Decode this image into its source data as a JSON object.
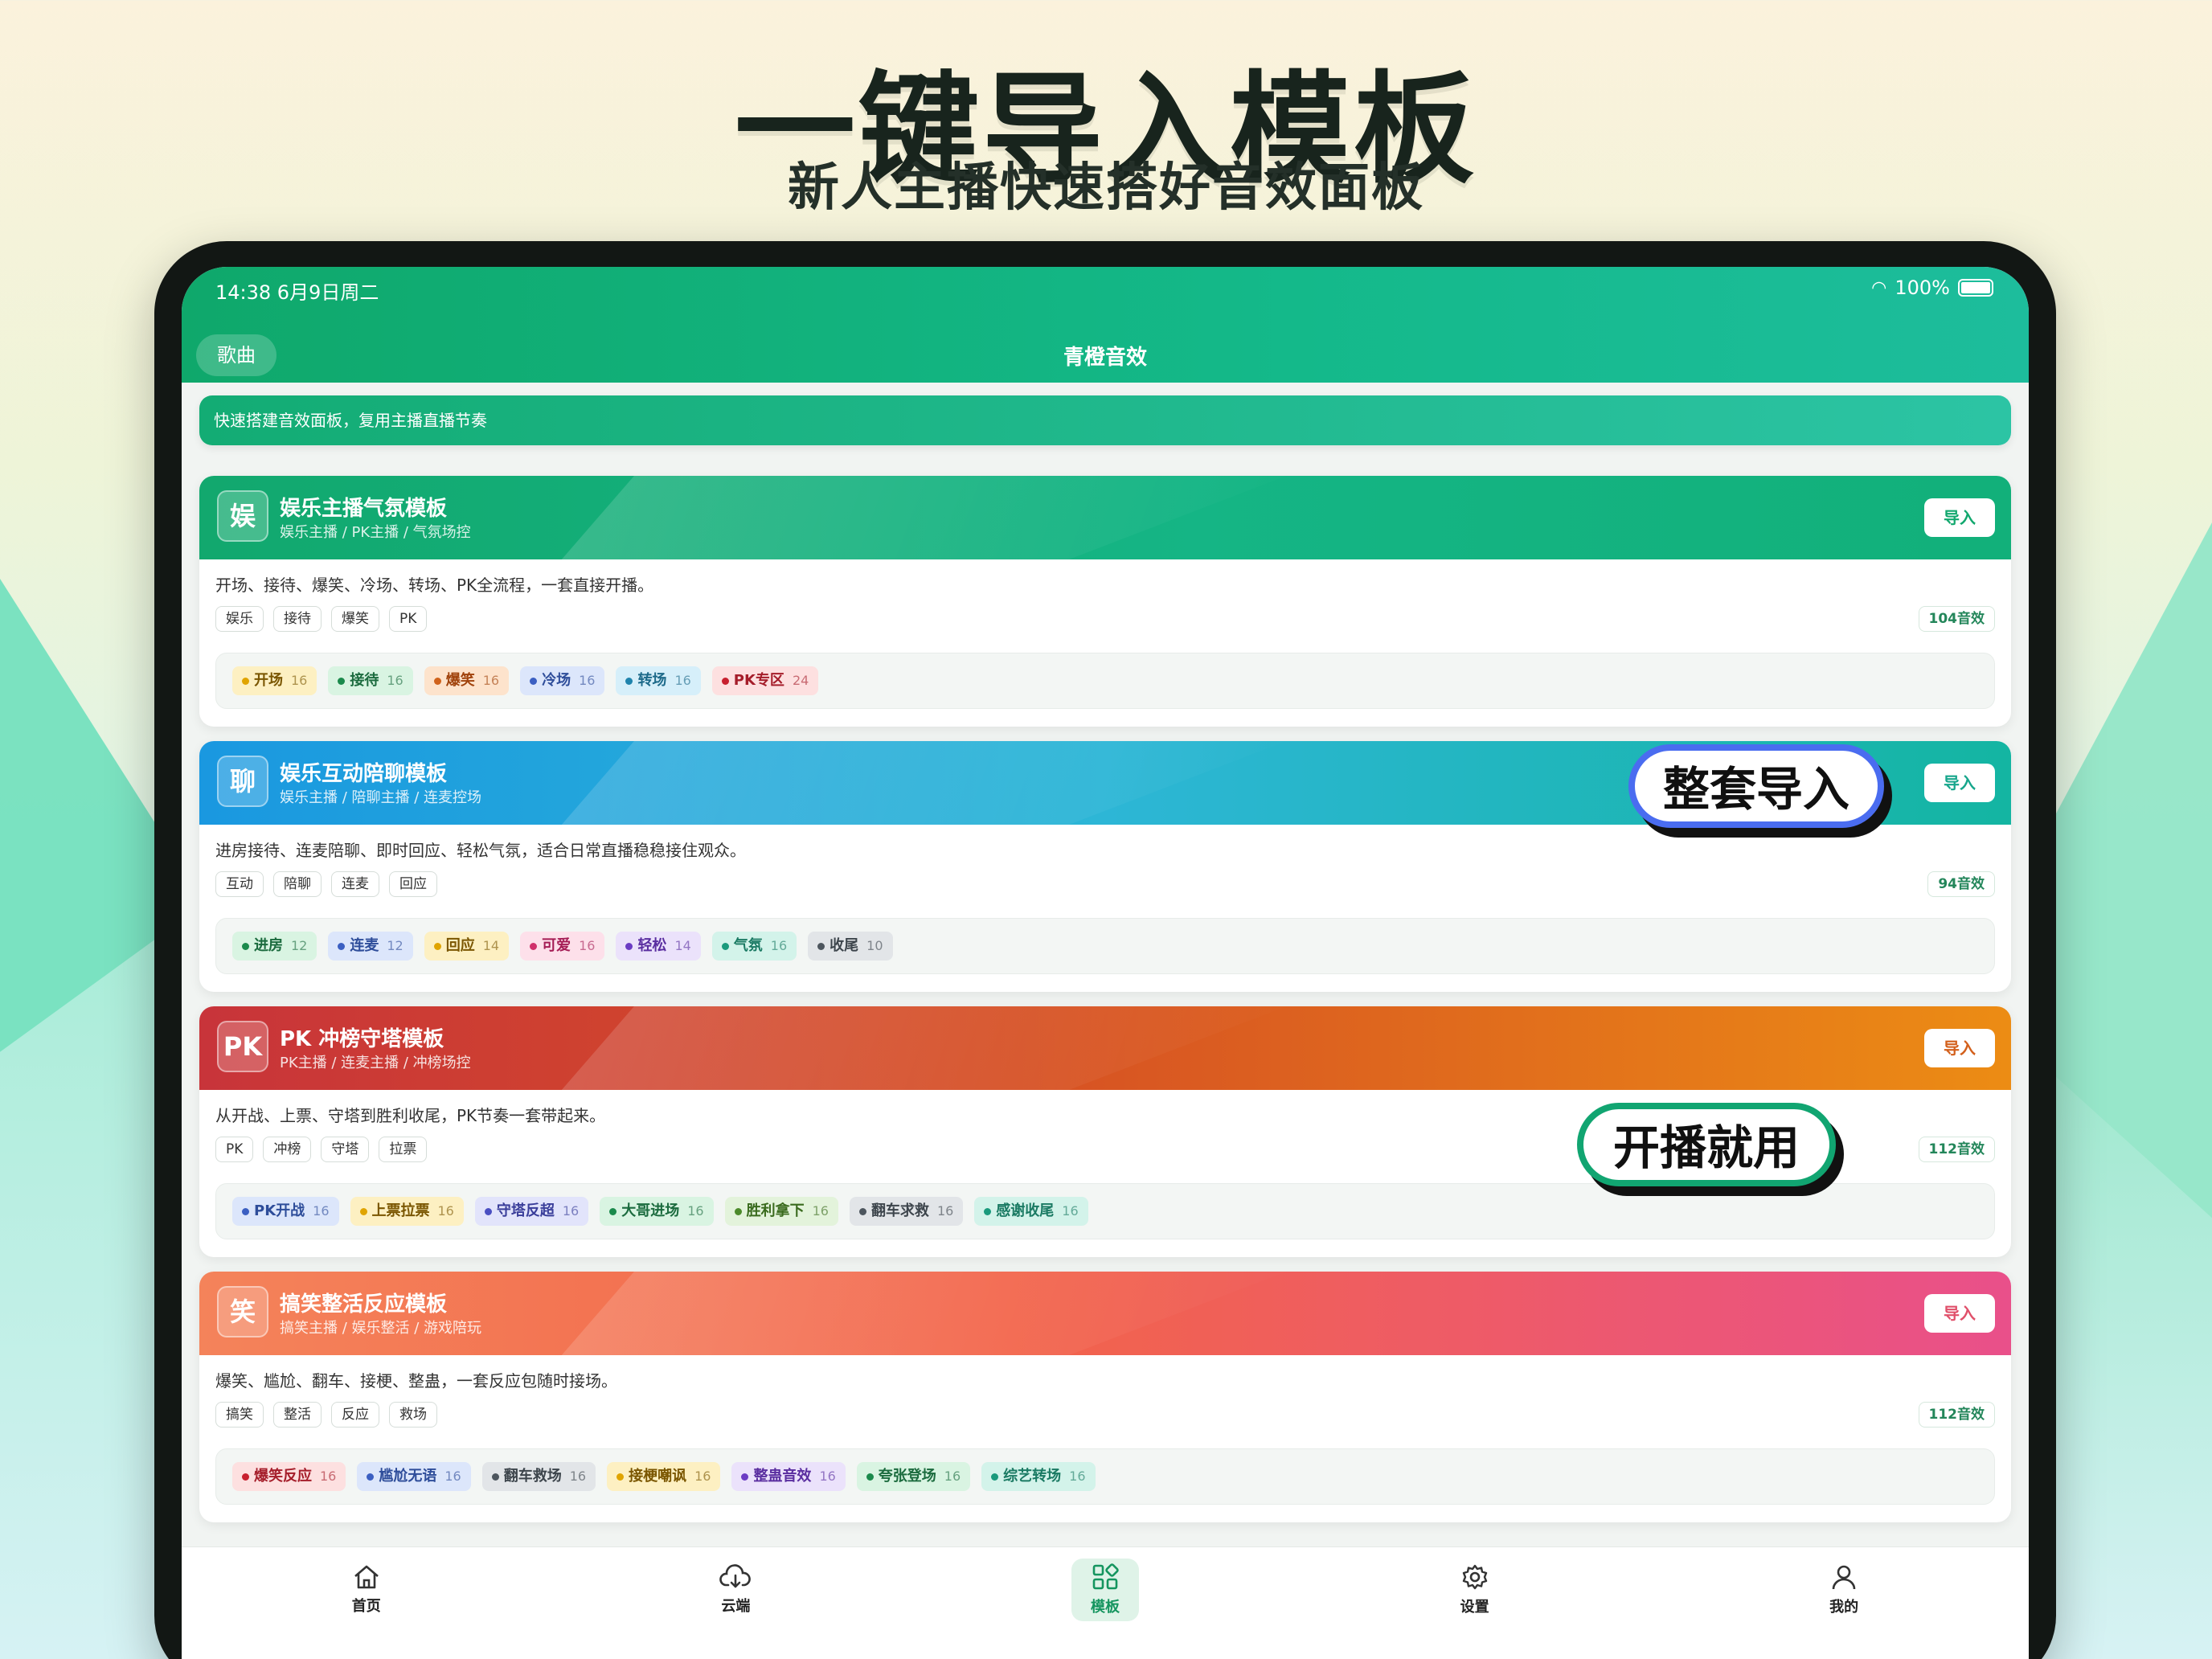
{
  "headline": "一键导入模板",
  "subline": "新人主播快速搭好音效面板",
  "status": {
    "time": "14:38  6月9日周二",
    "battery": "100%"
  },
  "header": {
    "left_button": "歌曲",
    "title": "青橙音效"
  },
  "banner": "快速搭建音效面板，复用主播直播节奏",
  "cards": [
    {
      "avatar": "娱",
      "title": "娱乐主播气氛模板",
      "subtitle": "娱乐主播 / PK主播 / 气氛场控",
      "import_label": "导入",
      "description": "开场、接待、爆笑、冷场、转场、PK全流程，一套直接开播。",
      "tags": [
        "娱乐",
        "接待",
        "爆笑",
        "PK"
      ],
      "count": "104音效",
      "chips": [
        {
          "label": "开场",
          "n": "16"
        },
        {
          "label": "接待",
          "n": "16"
        },
        {
          "label": "爆笑",
          "n": "16"
        },
        {
          "label": "冷场",
          "n": "16"
        },
        {
          "label": "转场",
          "n": "16"
        },
        {
          "label": "PK专区",
          "n": "24"
        }
      ]
    },
    {
      "avatar": "聊",
      "title": "娱乐互动陪聊模板",
      "subtitle": "娱乐主播 / 陪聊主播 / 连麦控场",
      "import_label": "导入",
      "description": "进房接待、连麦陪聊、即时回应、轻松气氛，适合日常直播稳稳接住观众。",
      "tags": [
        "互动",
        "陪聊",
        "连麦",
        "回应"
      ],
      "count": "94音效",
      "chips": [
        {
          "label": "进房",
          "n": "12"
        },
        {
          "label": "连麦",
          "n": "12"
        },
        {
          "label": "回应",
          "n": "14"
        },
        {
          "label": "可爱",
          "n": "16"
        },
        {
          "label": "轻松",
          "n": "14"
        },
        {
          "label": "气氛",
          "n": "16"
        },
        {
          "label": "收尾",
          "n": "10"
        }
      ]
    },
    {
      "avatar": "PK",
      "title": "PK 冲榜守塔模板",
      "subtitle": "PK主播 / 连麦主播 / 冲榜场控",
      "import_label": "导入",
      "description": "从开战、上票、守塔到胜利收尾，PK节奏一套带起来。",
      "tags": [
        "PK",
        "冲榜",
        "守塔",
        "拉票"
      ],
      "count": "112音效",
      "chips": [
        {
          "label": "PK开战",
          "n": "16"
        },
        {
          "label": "上票拉票",
          "n": "16"
        },
        {
          "label": "守塔反超",
          "n": "16"
        },
        {
          "label": "大哥进场",
          "n": "16"
        },
        {
          "label": "胜利拿下",
          "n": "16"
        },
        {
          "label": "翻车求救",
          "n": "16"
        },
        {
          "label": "感谢收尾",
          "n": "16"
        }
      ]
    },
    {
      "avatar": "笑",
      "title": "搞笑整活反应模板",
      "subtitle": "搞笑主播 / 娱乐整活 / 游戏陪玩",
      "import_label": "导入",
      "description": "爆笑、尴尬、翻车、接梗、整蛊，一套反应包随时接场。",
      "tags": [
        "搞笑",
        "整活",
        "反应",
        "救场"
      ],
      "count": "112音效",
      "chips": [
        {
          "label": "爆笑反应",
          "n": "16"
        },
        {
          "label": "尴尬无语",
          "n": "16"
        },
        {
          "label": "翻车救场",
          "n": "16"
        },
        {
          "label": "接梗嘲讽",
          "n": "16"
        },
        {
          "label": "整蛊音效",
          "n": "16"
        },
        {
          "label": "夸张登场",
          "n": "16"
        },
        {
          "label": "综艺转场",
          "n": "16"
        }
      ]
    }
  ],
  "callouts": {
    "whole_import": "整套导入",
    "start_now": "开播就用"
  },
  "tabs": [
    {
      "label": "首页",
      "icon": "home-icon"
    },
    {
      "label": "云端",
      "icon": "cloud-download-icon"
    },
    {
      "label": "模板",
      "icon": "grid-icon",
      "active": true
    },
    {
      "label": "设置",
      "icon": "gear-icon"
    },
    {
      "label": "我的",
      "icon": "user-icon"
    }
  ],
  "colors": {
    "brand_green": "#12ac72",
    "card_green": "#10b07a",
    "card_blue": "#1aa8d8",
    "card_red_orange": "#d9571f",
    "card_pink_orange": "#f0644c"
  }
}
